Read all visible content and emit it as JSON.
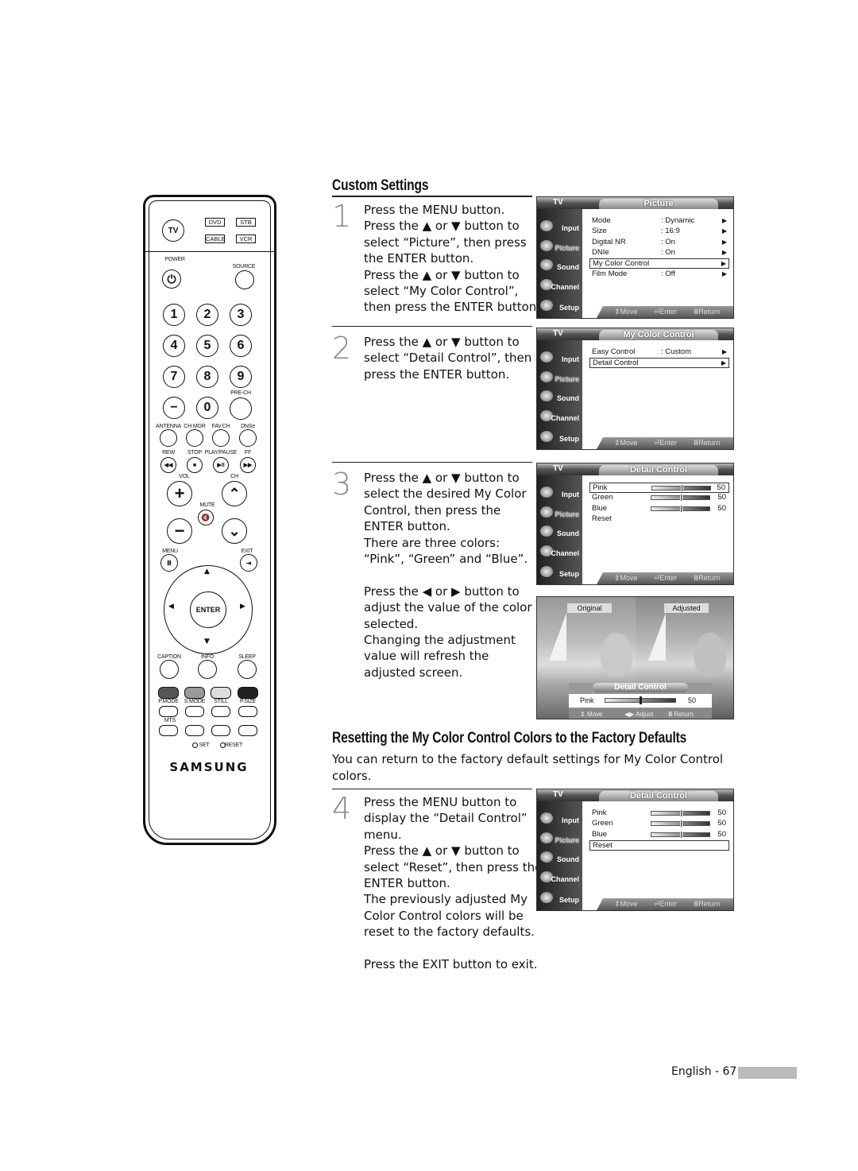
{
  "section1": {
    "title": "Custom Settings"
  },
  "steps": [
    {
      "number": "1",
      "lines": [
        "Press the MENU button.",
        "Press the ▲ or ▼ button to",
        "select “Picture”, then press",
        "the ENTER button.",
        "Press the ▲ or ▼ button to",
        "select “My Color Control”,",
        "then press the ENTER button."
      ]
    },
    {
      "number": "2",
      "lines": [
        "Press the ▲ or ▼ button to",
        "select “Detail Control”, then",
        "press the ENTER button."
      ]
    },
    {
      "number": "3",
      "lines": [
        "Press the ▲ or ▼ button to",
        "select the desired My Color",
        "Control, then press the",
        "ENTER button.",
        "There are three colors:",
        "“Pink”, “Green” and “Blue”.",
        "",
        "Press the ◀ or ▶ button to",
        "adjust the value of the color",
        "selected.",
        "Changing the adjustment",
        "value will refresh the",
        "adjusted screen."
      ]
    },
    {
      "number": "4",
      "lines": [
        "Press the MENU button to",
        "display the “Detail Control”",
        "menu.",
        "Press the ▲ or ▼ button to",
        "select “Reset”, then press the",
        "ENTER button.",
        "The previously adjusted My",
        "Color Control colors will be",
        "reset to the factory defaults.",
        "",
        "Press the EXIT button to exit."
      ]
    }
  ],
  "section2": {
    "title": "Resetting the My Color Control Colors to the Factory Defaults",
    "intro": [
      "You can return to the factory default settings for My Color Control",
      "colors."
    ]
  },
  "menu_common": {
    "tv_label": "TV",
    "sidebar": [
      "Input",
      "Picture",
      "Sound",
      "Channel",
      "Setup"
    ],
    "footer": {
      "move": "Move",
      "enter": "Enter",
      "return": "Return"
    }
  },
  "menus": [
    {
      "title": "Picture",
      "rows": [
        {
          "label": "Mode",
          "value": ": Dynamic",
          "arrow": true
        },
        {
          "label": "Size",
          "value": ": 16:9",
          "arrow": true
        },
        {
          "label": "Digital NR",
          "value": ": On",
          "arrow": true
        },
        {
          "label": "DNIe",
          "value": ": On",
          "arrow": true
        },
        {
          "label": "My Color Control",
          "value": "",
          "arrow": true,
          "selected": true
        },
        {
          "label": "Film Mode",
          "value": ": Off",
          "arrow": true
        }
      ]
    },
    {
      "title": "My Color Control",
      "rows": [
        {
          "label": "Easy Control",
          "value": ": Custom",
          "arrow": true
        },
        {
          "label": "Detail Control",
          "value": "",
          "arrow": true,
          "selected": true
        }
      ]
    },
    {
      "title": "Detail Control",
      "rows": [
        {
          "label": "Pink",
          "slider": 50,
          "selected": true
        },
        {
          "label": "Green",
          "slider": 50
        },
        {
          "label": "Blue",
          "slider": 50
        },
        {
          "label": "Reset"
        }
      ]
    },
    {
      "title": "Detail Control",
      "rows": [
        {
          "label": "Pink",
          "slider": 50
        },
        {
          "label": "Green",
          "slider": 50
        },
        {
          "label": "Blue",
          "slider": 50
        },
        {
          "label": "Reset",
          "selected": true
        }
      ]
    }
  ],
  "photo": {
    "original_label": "Original",
    "adjusted_label": "Adjusted",
    "osd_title": "Detail Control",
    "osd_item": "Pink",
    "osd_value": "50",
    "osd_level": 50,
    "footer": {
      "move": "Move",
      "adjust": "Adjust",
      "return": "Return"
    }
  },
  "remote": {
    "tv": "TV",
    "dvd": "DVD",
    "stb": "STB",
    "cable": "CABLE",
    "vcr": "VCR",
    "power": "POWER",
    "source": "SOURCE",
    "digits": [
      "1",
      "2",
      "3",
      "4",
      "5",
      "6",
      "7",
      "8",
      "9",
      "−",
      "0"
    ],
    "pre_ch": "PRE-CH",
    "row_labels": [
      "ANTENNA",
      "CH MGR",
      "FAV.CH",
      "DNSe"
    ],
    "transport_labels": [
      "REW",
      "STOP",
      "PLAY/PAUSE",
      "FF"
    ],
    "transport_glyphs": [
      "◀◀",
      "■",
      "▶II",
      "▶▶"
    ],
    "vol": "VOL",
    "ch": "CH",
    "mute": "MUTE",
    "menu": "MENU",
    "exit": "EXIT",
    "enter": "ENTER",
    "func_labels": [
      "CAPTION",
      "INFO",
      "SLEEP"
    ],
    "mode_labels": [
      "P.MODE",
      "S.MODE",
      "STILL",
      "P.SIZE"
    ],
    "mts": "MTS",
    "set": "SET",
    "reset": "RESET",
    "brand": "SAMSUNG"
  },
  "footer": {
    "page_label": "English - 67"
  }
}
